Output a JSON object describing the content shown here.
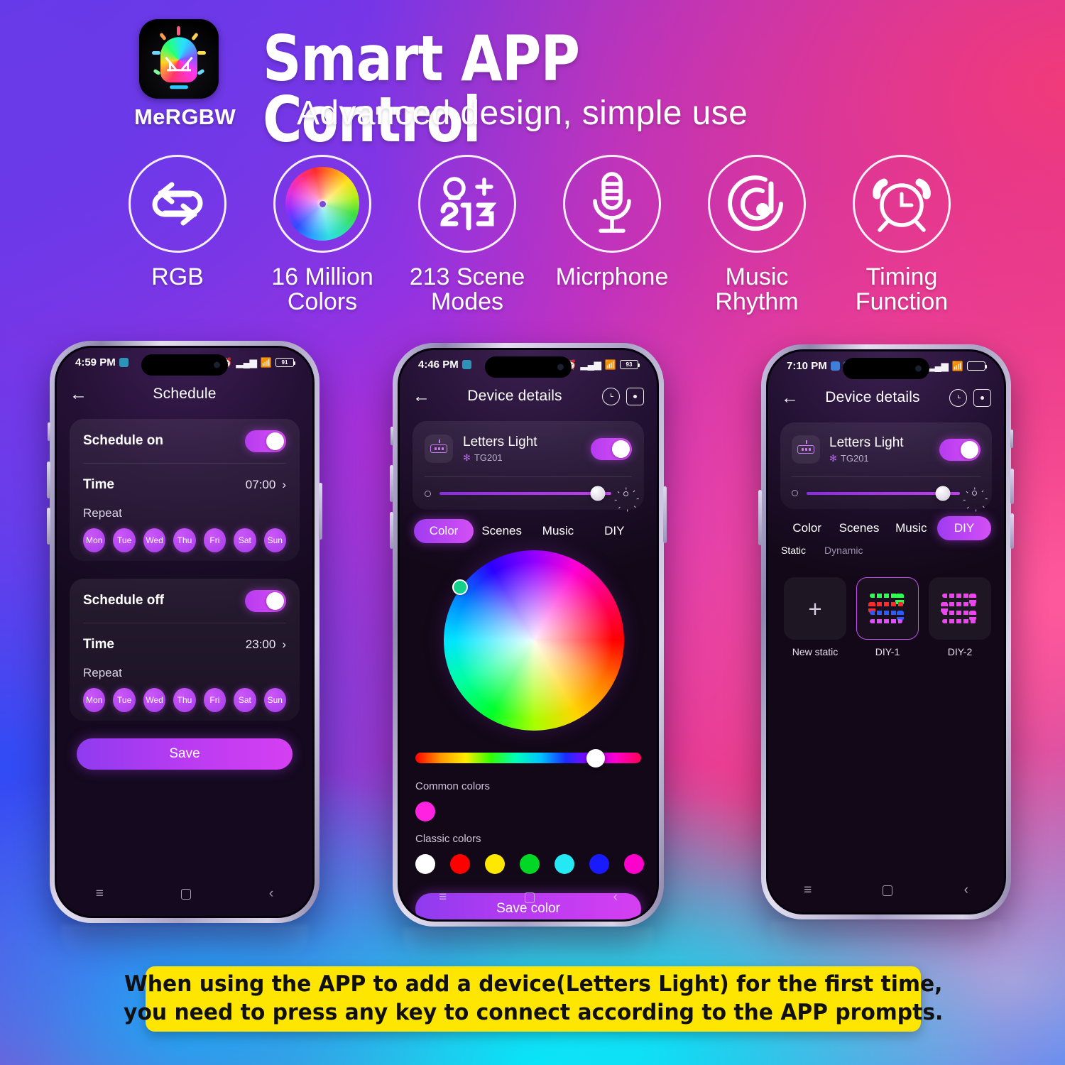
{
  "header": {
    "app_name": "MeRGBW",
    "title": "Smart APP Control",
    "subtitle": "Advanced design, simple use"
  },
  "features": [
    {
      "icon": "loop-arrows-icon",
      "label": "RGB"
    },
    {
      "icon": "color-wheel-icon",
      "label": "16 Million\nColors"
    },
    {
      "icon": "scene-213-icon",
      "label": "213 Scene\nModes"
    },
    {
      "icon": "microphone-icon",
      "label": "Micrphone"
    },
    {
      "icon": "music-rhythm-icon",
      "label": "Music\nRhythm"
    },
    {
      "icon": "alarm-clock-icon",
      "label": "Timing\nFunction"
    }
  ],
  "phones": [
    {
      "id": "phone-schedule",
      "status": {
        "time": "4:59 PM",
        "battery": "91"
      },
      "screen_title": "Schedule",
      "schedule_on": {
        "label": "Schedule on",
        "toggle": "on",
        "time_label": "Time",
        "time_value": "07:00",
        "repeat_label": "Repeat",
        "days": [
          "Mon",
          "Tue",
          "Wed",
          "Thu",
          "Fri",
          "Sat",
          "Sun"
        ]
      },
      "schedule_off": {
        "label": "Schedule off",
        "toggle": "on",
        "time_label": "Time",
        "time_value": "23:00",
        "repeat_label": "Repeat",
        "days": [
          "Mon",
          "Tue",
          "Wed",
          "Thu",
          "Fri",
          "Sat",
          "Sun"
        ]
      },
      "save_label": "Save"
    },
    {
      "id": "phone-color",
      "status": {
        "time": "4:46 PM",
        "battery": "93"
      },
      "screen_title": "Device details",
      "device": {
        "name": "Letters Light",
        "model": "TG201",
        "toggle": "on",
        "brightness_percent": 92
      },
      "tabs": [
        "Color",
        "Scenes",
        "Music",
        "DIY"
      ],
      "active_tab": "Color",
      "common_colors_label": "Common colors",
      "common_colors": [
        "#ff22e0"
      ],
      "classic_colors_label": "Classic colors",
      "classic_colors": [
        "#ffffff",
        "#ff0000",
        "#ffe800",
        "#00d825",
        "#25e8f5",
        "#1a1aff",
        "#ff00cc"
      ],
      "hue_position_percent": 78,
      "save_color_label": "Save color"
    },
    {
      "id": "phone-diy",
      "status": {
        "time": "7:10 PM",
        "battery": ""
      },
      "screen_title": "Device details",
      "device": {
        "name": "Letters Light",
        "model": "TG201",
        "toggle": "on",
        "brightness_percent": 89
      },
      "tabs": [
        "Color",
        "Scenes",
        "Music",
        "DIY"
      ],
      "active_tab": "DIY",
      "subtabs": [
        "Static",
        "Dynamic"
      ],
      "active_subtab": "Static",
      "tiles": [
        {
          "label": "New static",
          "type": "add",
          "selected": false
        },
        {
          "label": "DIY-1",
          "type": "preset-multicolor",
          "selected": true
        },
        {
          "label": "DIY-2",
          "type": "preset-magenta",
          "selected": false
        }
      ]
    }
  ],
  "banner": {
    "line1": "When using the APP to add a device(Letters Light) for the first time,",
    "line2": "you need to press any key to connect according to the APP prompts."
  },
  "colors": {
    "accent": "#b93bf2",
    "banner_bg": "#ffe600",
    "toggle_on": "#c23ef0"
  }
}
